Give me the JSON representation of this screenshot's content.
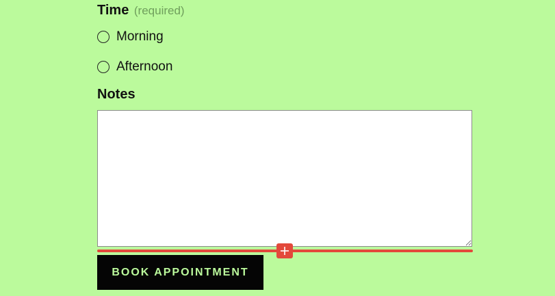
{
  "form": {
    "time_field": {
      "label": "Time",
      "required_text": "(required)",
      "options": [
        {
          "label": "Morning",
          "selected": false
        },
        {
          "label": "Afternoon",
          "selected": false
        }
      ]
    },
    "notes_field": {
      "label": "Notes",
      "value": ""
    },
    "insert_block_icon": "plus-icon",
    "submit_label": "BOOK APPOINTMENT"
  },
  "colors": {
    "page_background": "#bbfa9c",
    "accent_red": "#e3493b",
    "button_background": "#050505",
    "button_text": "#bbfa9c",
    "required_text": "#6f9f5c"
  }
}
